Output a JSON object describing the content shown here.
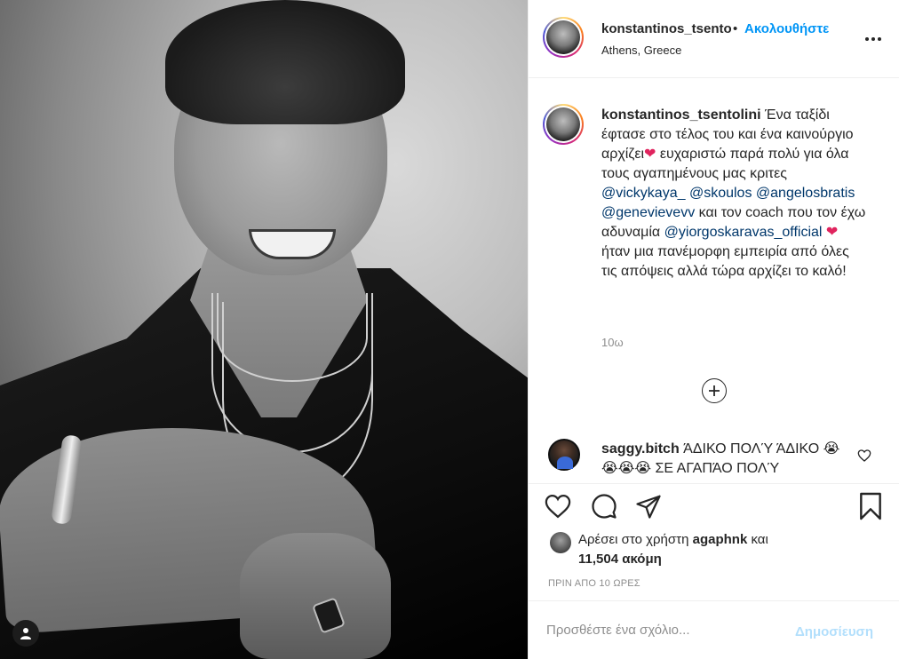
{
  "post": {
    "header": {
      "username": "konstantinos_tsentolini",
      "separator": "•",
      "follow_label": "Ακολουθήστε",
      "location": "Athens, Greece"
    },
    "caption": {
      "username": "konstantinos_tsentolini",
      "text_1": "Ένα ταξίδι έφτασε στο τέλος του και ένα καινούργιο αρχίζει",
      "text_2": "ευχαριστώ παρά πολύ για όλα τους αγαπημένους μας κριτες",
      "mentions": [
        "@vickykaya_",
        "@skoulos",
        "@angelosbratis",
        "@genevievevv"
      ],
      "text_3": "και τον coach που τον έχω αδυναμία",
      "coach_mention": "@yiorgoskaravas_official",
      "text_4": "ήταν μια πανέμορφη εμπειρία από όλες τις απόψεις αλλά τώρα αρχίζει το καλό!",
      "heart": "❤",
      "time": "10ω"
    },
    "comment": {
      "username": "saggy.bitch",
      "text": "ΆΔΙΚΟ ΠΟΛΎ ΆΔΙΚΟ 😭😭😭😭 ΣΕ ΑΓΑΠΆΟ ΠΟΛΎ"
    },
    "likes": {
      "prefix": "Αρέσει στο χρήστη",
      "liker": "agaphnk",
      "and": "και",
      "count_text": "11,504 ακόμη"
    },
    "posted_ago": "ΠΡΙΝ ΑΠΟ 10 ΩΡΕΣ",
    "add_comment": {
      "placeholder": "Προσθέστε ένα σχόλιο...",
      "publish_label": "Δημοσίευση"
    }
  },
  "icons": {
    "like": "heart-icon",
    "comment": "comment-icon",
    "share": "share-icon",
    "save": "bookmark-icon",
    "more": "more-options-icon",
    "tags": "user-tag-icon",
    "load_more": "plus-circle-icon"
  },
  "colors": {
    "link_blue": "#0095f6",
    "mention_blue": "#00376b",
    "publish_disabled": "#b2dffc",
    "heart_red": "#e0245e"
  }
}
